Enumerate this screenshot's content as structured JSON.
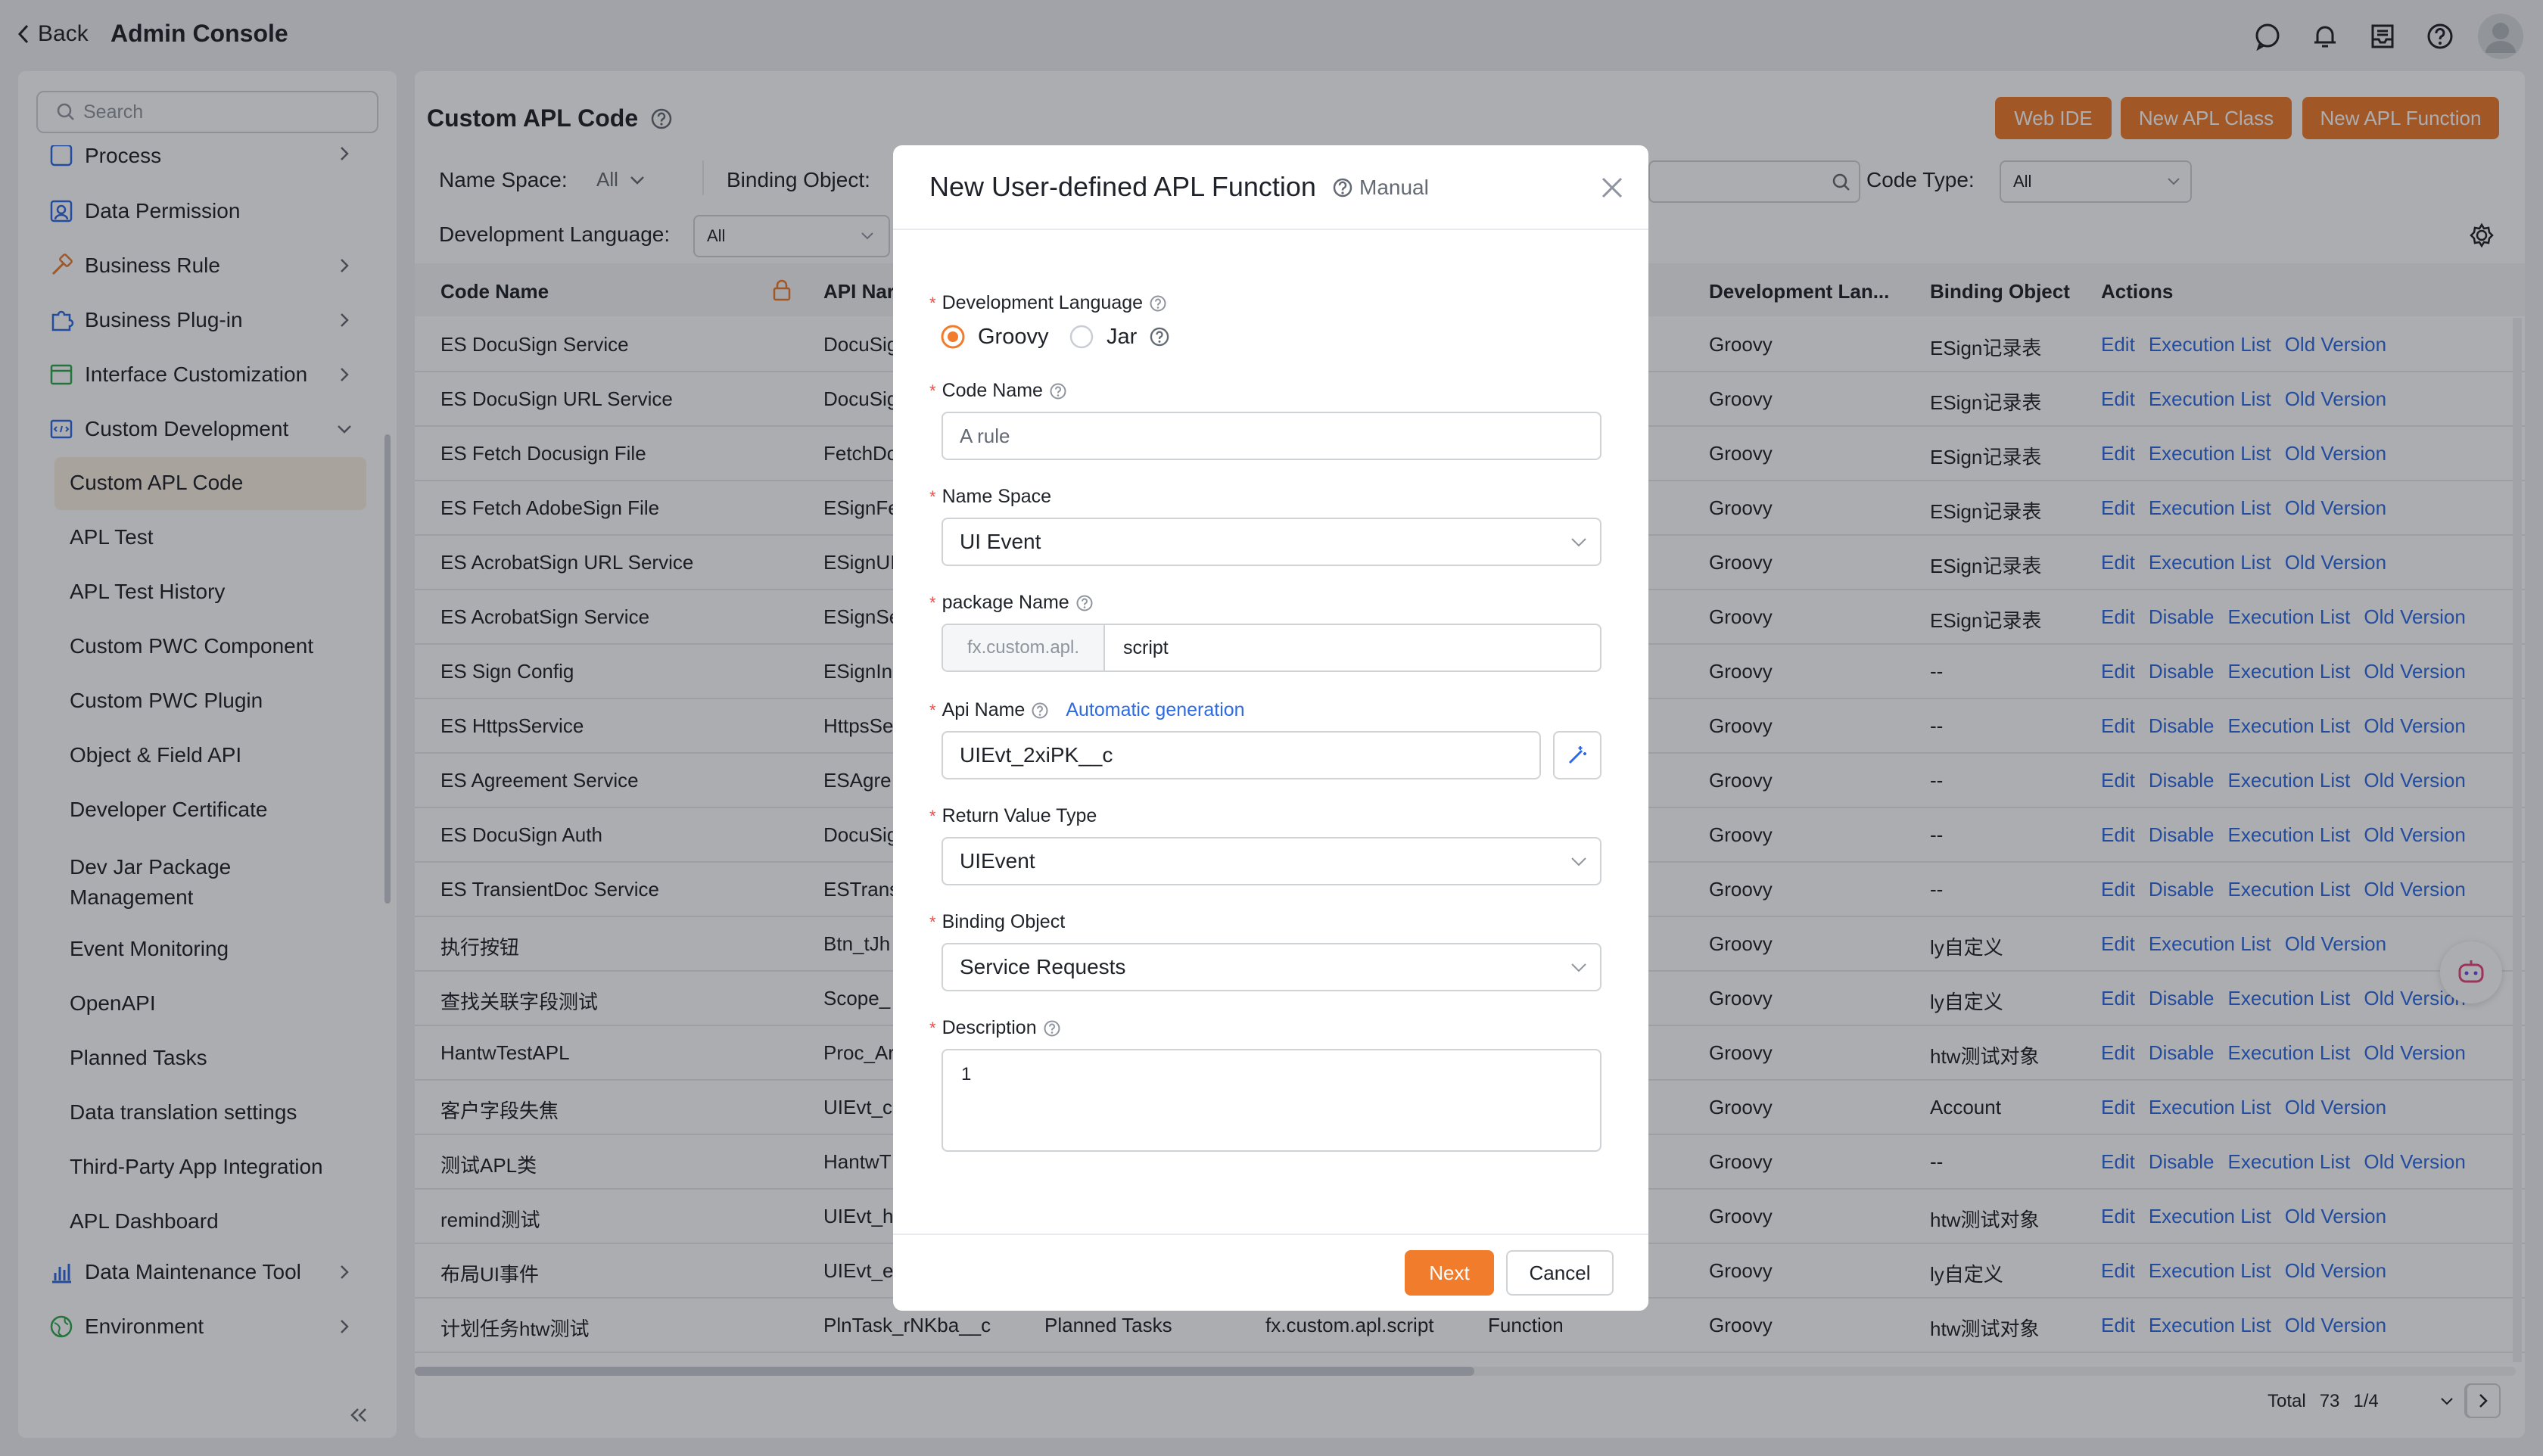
{
  "topbar": {
    "back_label": "Back",
    "app_title": "Admin Console"
  },
  "sidebar": {
    "search_placeholder": "Search",
    "items": [
      {
        "label": "Process"
      },
      {
        "label": "Data Permission"
      },
      {
        "label": "Business Rule"
      },
      {
        "label": "Business Plug-in"
      },
      {
        "label": "Interface Customization"
      },
      {
        "label": "Custom Development"
      }
    ],
    "sub_items": [
      "Custom APL Code",
      "APL Test",
      "APL Test History",
      "Custom PWC Component",
      "Custom PWC Plugin",
      "Object & Field API",
      "Developer Certificate",
      "Dev Jar Package Management",
      "Event Monitoring",
      "OpenAPI",
      "Planned Tasks",
      "Data translation settings",
      "Third-Party App Integration",
      "APL Dashboard"
    ],
    "bottom_items": [
      {
        "label": "Data Maintenance Tool"
      },
      {
        "label": "Environment"
      }
    ]
  },
  "main": {
    "title": "Custom APL Code",
    "buttons": {
      "web_ide": "Web IDE",
      "new_class": "New APL Class",
      "new_function": "New APL Function"
    },
    "filters": {
      "name_space_label": "Name Space:",
      "name_space_value": "All",
      "binding_object_label": "Binding Object:",
      "code_type_label": "Code Type:",
      "code_type_value": "All",
      "dev_lang_label": "Development Language:",
      "dev_lang_value": "All"
    },
    "columns": {
      "code_name": "Code Name",
      "api_name": "API Nar",
      "dev_lang": "Development Lan...",
      "binding": "Binding Object",
      "actions": "Actions"
    },
    "rows": [
      {
        "code": "ES DocuSign Service",
        "api": "DocuSig",
        "lang": "Groovy",
        "binding": "ESign记录表",
        "actions": [
          "Edit",
          "Execution List",
          "Old Version"
        ]
      },
      {
        "code": "ES DocuSign URL Service",
        "api": "DocuSig",
        "lang": "Groovy",
        "binding": "ESign记录表",
        "actions": [
          "Edit",
          "Execution List",
          "Old Version"
        ]
      },
      {
        "code": "ES Fetch Docusign File",
        "api": "FetchDc",
        "lang": "Groovy",
        "binding": "ESign记录表",
        "actions": [
          "Edit",
          "Execution List",
          "Old Version"
        ]
      },
      {
        "code": "ES Fetch AdobeSign File",
        "api": "ESignFe",
        "lang": "Groovy",
        "binding": "ESign记录表",
        "actions": [
          "Edit",
          "Execution List",
          "Old Version"
        ]
      },
      {
        "code": "ES AcrobatSign URL Service",
        "api": "ESignUI",
        "lang": "Groovy",
        "binding": "ESign记录表",
        "actions": [
          "Edit",
          "Execution List",
          "Old Version"
        ]
      },
      {
        "code": "ES AcrobatSign Service",
        "api": "ESignSe",
        "lang": "Groovy",
        "binding": "ESign记录表",
        "actions": [
          "Edit",
          "Disable",
          "Execution List",
          "Old Version"
        ]
      },
      {
        "code": "ES Sign Config",
        "api": "ESignIn",
        "lang": "Groovy",
        "binding": "--",
        "actions": [
          "Edit",
          "Disable",
          "Execution List",
          "Old Version"
        ]
      },
      {
        "code": "ES HttpsService",
        "api": "HttpsSe",
        "lang": "Groovy",
        "binding": "--",
        "actions": [
          "Edit",
          "Disable",
          "Execution List",
          "Old Version"
        ]
      },
      {
        "code": "ES Agreement Service",
        "api": "ESAgre",
        "lang": "Groovy",
        "binding": "--",
        "actions": [
          "Edit",
          "Disable",
          "Execution List",
          "Old Version"
        ]
      },
      {
        "code": "ES DocuSign Auth",
        "api": "DocuSig",
        "lang": "Groovy",
        "binding": "--",
        "actions": [
          "Edit",
          "Disable",
          "Execution List",
          "Old Version"
        ]
      },
      {
        "code": "ES TransientDoc Service",
        "api": "ESTrans",
        "lang": "Groovy",
        "binding": "--",
        "actions": [
          "Edit",
          "Disable",
          "Execution List",
          "Old Version"
        ]
      },
      {
        "code": "执行按钮",
        "api": "Btn_tJh",
        "lang": "Groovy",
        "binding": "ly自定义",
        "actions": [
          "Edit",
          "Execution List",
          "Old Version"
        ]
      },
      {
        "code": "查找关联字段测试",
        "api": "Scope_",
        "lang": "Groovy",
        "binding": "ly自定义",
        "actions": [
          "Edit",
          "Disable",
          "Execution List",
          "Old Version"
        ]
      },
      {
        "code": "HantwTestAPL",
        "api": "Proc_Ar",
        "lang": "Groovy",
        "binding": "htw测试对象",
        "actions": [
          "Edit",
          "Disable",
          "Execution List",
          "Old Version"
        ]
      },
      {
        "code": "客户字段失焦",
        "api": "UIEvt_c",
        "lang": "Groovy",
        "binding": "Account",
        "actions": [
          "Edit",
          "Execution List",
          "Old Version"
        ]
      },
      {
        "code": "测试APL类",
        "api": "HantwT",
        "lang": "Groovy",
        "binding": "--",
        "actions": [
          "Edit",
          "Disable",
          "Execution List",
          "Old Version"
        ]
      },
      {
        "code": "remind测试",
        "api": "UIEvt_h",
        "lang": "Groovy",
        "binding": "htw测试对象",
        "actions": [
          "Edit",
          "Execution List",
          "Old Version"
        ]
      },
      {
        "code": "布局UI事件",
        "api": "UIEvt_e",
        "lang": "Groovy",
        "binding": "ly自定义",
        "actions": [
          "Edit",
          "Execution List",
          "Old Version"
        ]
      },
      {
        "code": "计划任务htw测试",
        "api": "PlnTask_rNKba__c",
        "lang": "Groovy",
        "binding": "htw测试对象",
        "actions": [
          "Edit",
          "Execution List",
          "Old Version"
        ],
        "extra": [
          "Planned Tasks",
          "fx.custom.apl.script",
          "Function"
        ]
      }
    ],
    "pagination": {
      "total_label": "Total",
      "total": "73",
      "page": "1/4"
    }
  },
  "modal": {
    "title": "New User-defined APL Function",
    "manual_label": "Manual",
    "fields": {
      "dev_lang": {
        "label": "Development Language",
        "options": [
          "Groovy",
          "Jar"
        ]
      },
      "code_name": {
        "label": "Code Name",
        "placeholder": "A rule"
      },
      "name_space": {
        "label": "Name Space",
        "value": "UI Event"
      },
      "package_name": {
        "label": "package Name",
        "prefix": "fx.custom.apl.",
        "value": "script"
      },
      "api_name": {
        "label": "Api Name",
        "auto_link": "Automatic generation",
        "value": "UIEvt_2xiPK__c"
      },
      "return_type": {
        "label": "Return Value Type",
        "value": "UIEvent"
      },
      "binding_object": {
        "label": "Binding Object",
        "value": "Service Requests"
      },
      "description": {
        "label": "Description",
        "value": "1"
      }
    },
    "next_label": "Next",
    "cancel_label": "Cancel"
  },
  "colors": {
    "accent": "#f07c2c",
    "link": "#2d6ae3",
    "required": "#f54a45"
  }
}
